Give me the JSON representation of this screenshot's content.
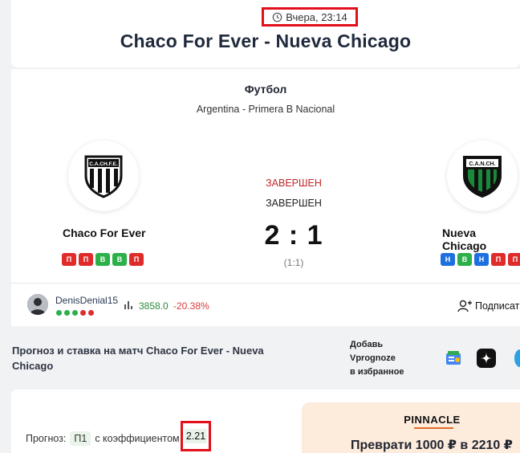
{
  "header": {
    "date": "Вчера, 23:14",
    "title": "Chaco For Ever - Nueva Chicago"
  },
  "match": {
    "sport": "Футбол",
    "league": "Argentina - Primera B Nacional",
    "status_primary": "ЗАВЕРШЕН",
    "status_secondary": "ЗАВЕРШЕН",
    "score": "2 : 1",
    "halftime": "(1:1)",
    "home": {
      "name": "Chaco For Ever",
      "logo_text": "C.A.CH.F.E.",
      "form": [
        "П",
        "П",
        "В",
        "В",
        "П"
      ]
    },
    "away": {
      "name": "Nueva Chicago",
      "logo_text": "C.A.N.CH.",
      "form": [
        "Н",
        "В",
        "Н",
        "П",
        "П"
      ]
    }
  },
  "author": {
    "name": "DenisDenial15",
    "rating": "3858.0",
    "roi": "-20.38%",
    "dots": [
      "#2bb04a",
      "#2bb04a",
      "#2bb04a",
      "#2bb04a",
      "#e02b2b"
    ],
    "subscribe_label": "Подписаться"
  },
  "forecast_section": {
    "title": "Прогноз и ставка на матч Chaco For Ever - Nueva Chicago",
    "favorites_line1": "Добавь",
    "favorites_line2": "Vprognoze",
    "favorites_line3": "в избранное"
  },
  "forecast": {
    "label": "Прогноз:",
    "pick": "П1",
    "with_odds": "с коэффициентом",
    "odds": "2.21"
  },
  "promo": {
    "brand": "PINNACLE",
    "text": "Преврати 1000 ₽ в 2210 ₽"
  },
  "colors": {
    "highlight": "#e3101b",
    "win": "#2bb04a",
    "loss": "#e02b2b",
    "draw": "#1e6fe0",
    "status_red": "#c0282b"
  }
}
